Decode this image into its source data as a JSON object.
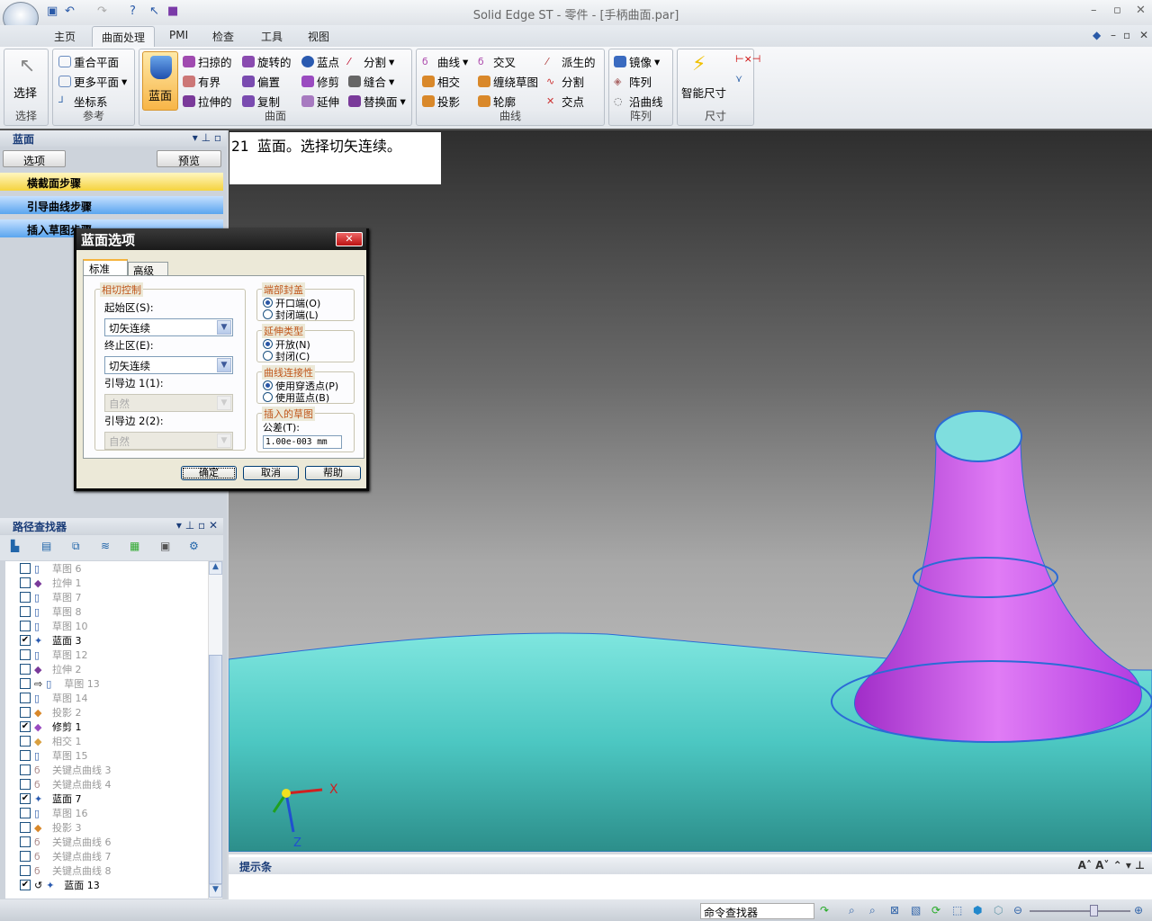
{
  "app": {
    "title": "Solid Edge ST - 零件 - [手柄曲面.par]"
  },
  "ribbon": {
    "tabs": [
      "主页",
      "曲面处理",
      "PMI",
      "检查",
      "工具",
      "视图"
    ],
    "active_tab": "曲面处理",
    "groups": {
      "select": {
        "label": "选择",
        "button": "选择"
      },
      "reference": {
        "label": "参考",
        "items": [
          "重合平面",
          "更多平面",
          "坐标系"
        ]
      },
      "surface": {
        "label": "曲面",
        "big": "蓝面",
        "items": [
          "扫掠的",
          "旋转的",
          "蓝点",
          "分割",
          "有界",
          "偏置",
          "修剪",
          "缝合",
          "拉伸的",
          "复制",
          "延伸",
          "替换面"
        ]
      },
      "curve": {
        "label": "曲线",
        "items": [
          "曲线",
          "交叉",
          "派生的",
          "相交",
          "缠绕草图",
          "分割",
          "投影",
          "轮廓",
          "交点"
        ]
      },
      "pattern": {
        "label": "阵列",
        "items": [
          "镜像",
          "阵列",
          "沿曲线"
        ]
      },
      "dimension": {
        "label": "尺寸",
        "big": "智能尺寸"
      }
    }
  },
  "bluesurf_panel": {
    "title": "蓝面",
    "options_btn": "选项",
    "preview_btn": "预览",
    "steps": [
      "横截面步骤",
      "引导曲线步骤",
      "插入草图步骤"
    ]
  },
  "tooltip": "21 蓝面。选择切矢连续。",
  "dialog": {
    "title": "蓝面选项",
    "tabs": [
      "标准",
      "高级"
    ],
    "tangent": {
      "legend": "相切控制",
      "start_label": "起始区(S):",
      "start_value": "切矢连续",
      "end_label": "终止区(E):",
      "end_value": "切矢连续",
      "guide1_label": "引导边 1(1):",
      "guide1_value": "自然",
      "guide2_label": "引导边 2(2):",
      "guide2_value": "自然"
    },
    "endcap": {
      "legend": "端部封盖",
      "options": [
        "开口端(O)",
        "封闭端(L)"
      ],
      "selected": 0
    },
    "extend": {
      "legend": "延伸类型",
      "options": [
        "开放(N)",
        "封闭(C)"
      ],
      "selected": 0
    },
    "curve_conn": {
      "legend": "曲线连接性",
      "options": [
        "使用穿透点(P)",
        "使用蓝点(B)"
      ],
      "selected": 0
    },
    "inserted": {
      "legend": "插入的草图",
      "tol_label": "公差(T):",
      "tol_value": "1.00e-003 mm"
    },
    "ok": "确定",
    "cancel": "取消",
    "help": "帮助"
  },
  "pathfinder": {
    "title": "路径查找器",
    "items": [
      {
        "label": "草图 6",
        "checked": false,
        "icon": "sketch"
      },
      {
        "label": "拉伸 1",
        "checked": false,
        "icon": "extrude"
      },
      {
        "label": "草图 7",
        "checked": false,
        "icon": "sketch"
      },
      {
        "label": "草图 8",
        "checked": false,
        "icon": "sketch"
      },
      {
        "label": "草图 10",
        "checked": false,
        "icon": "sketch"
      },
      {
        "label": "蓝面 3",
        "checked": true,
        "icon": "bluesurf"
      },
      {
        "label": "草图 12",
        "checked": false,
        "icon": "sketch"
      },
      {
        "label": "拉伸 2",
        "checked": false,
        "icon": "extrude"
      },
      {
        "label": "草图 13",
        "checked": false,
        "icon": "sketch",
        "prefix": "arrow"
      },
      {
        "label": "草图 14",
        "checked": false,
        "icon": "sketch"
      },
      {
        "label": "投影 2",
        "checked": false,
        "icon": "project"
      },
      {
        "label": "修剪 1",
        "checked": true,
        "icon": "trim"
      },
      {
        "label": "相交 1",
        "checked": false,
        "icon": "intersect"
      },
      {
        "label": "草图 15",
        "checked": false,
        "icon": "sketch"
      },
      {
        "label": "关键点曲线 3",
        "checked": false,
        "icon": "curve"
      },
      {
        "label": "关键点曲线 4",
        "checked": false,
        "icon": "curve"
      },
      {
        "label": "蓝面 7",
        "checked": true,
        "icon": "bluesurf"
      },
      {
        "label": "草图 16",
        "checked": false,
        "icon": "sketch"
      },
      {
        "label": "投影 3",
        "checked": false,
        "icon": "project"
      },
      {
        "label": "关键点曲线 6",
        "checked": false,
        "icon": "curve"
      },
      {
        "label": "关键点曲线 7",
        "checked": false,
        "icon": "curve"
      },
      {
        "label": "关键点曲线 8",
        "checked": false,
        "icon": "curve"
      },
      {
        "label": "蓝面 13",
        "checked": true,
        "icon": "bluesurf",
        "prefix": "rollback"
      }
    ]
  },
  "viewport": {
    "axes": {
      "x": "X",
      "z": "Z"
    },
    "surface_color": "#5fd6d0",
    "feature_color": "#c03ae8"
  },
  "hintbar": {
    "title": "提示条"
  },
  "status": {
    "command_finder": "命令查找器"
  }
}
